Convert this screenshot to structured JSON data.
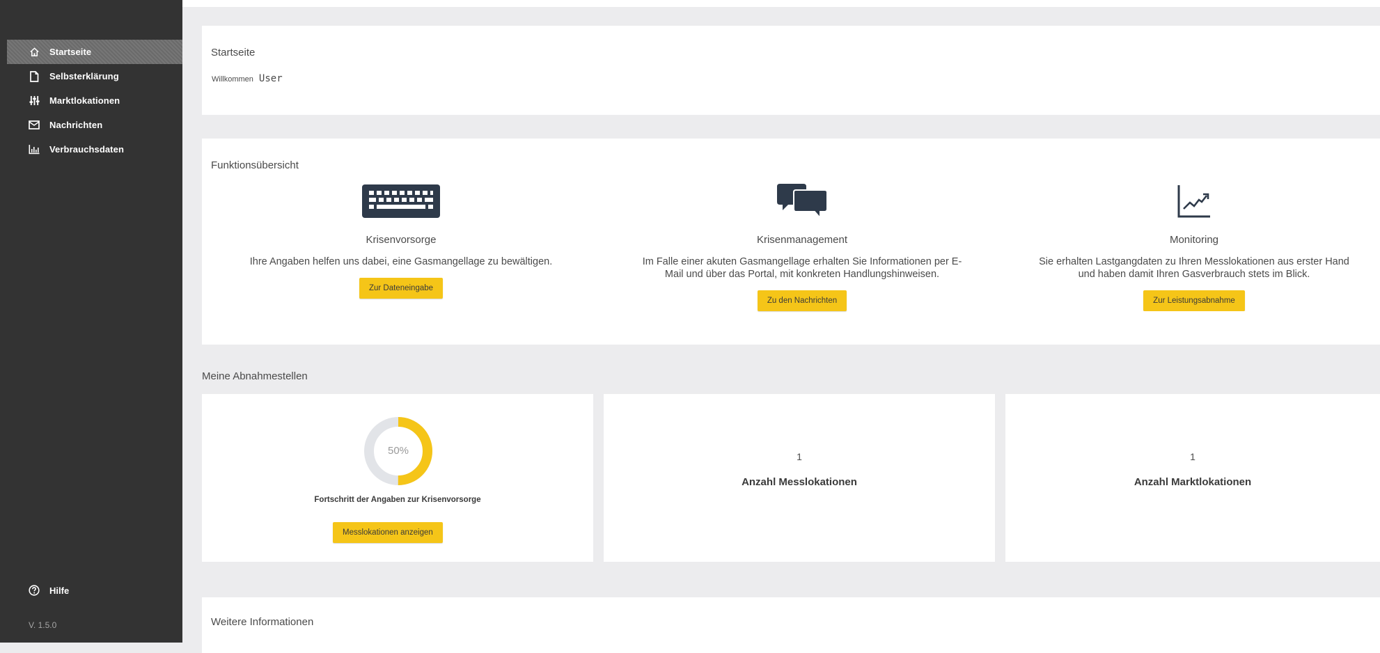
{
  "sidebar": {
    "items": [
      {
        "label": "Startseite",
        "icon": "home-icon"
      },
      {
        "label": "Selbsterklärung",
        "icon": "file-icon"
      },
      {
        "label": "Marktlokationen",
        "icon": "sliders-icon"
      },
      {
        "label": "Nachrichten",
        "icon": "mail-icon"
      },
      {
        "label": "Verbrauchsdaten",
        "icon": "bar-chart-icon"
      }
    ],
    "help_label": "Hilfe",
    "version": "V. 1.5.0"
  },
  "welcome": {
    "title": "Startseite",
    "greeting": "Willkommen",
    "user": "User"
  },
  "features": {
    "title": "Funktionsübersicht",
    "items": [
      {
        "name": "Krisenvorsorge",
        "icon": "keyboard-icon",
        "desc_line1": "Ihre Angaben helfen uns dabei, eine Gasmangellage zu bewältigen.",
        "desc_line2": "",
        "button": "Zur Dateneingabe"
      },
      {
        "name": "Krisenmanagement",
        "icon": "chat-icon",
        "desc_line1": "Im Falle einer akuten Gasmangellage erhalten Sie Informationen per E-",
        "desc_line2": "Mail und über das Portal, mit konkreten Handlungshinweisen.",
        "button": "Zu den Nachrichten"
      },
      {
        "name": "Monitoring",
        "icon": "trend-chart-icon",
        "desc_line1": "Sie erhalten Lastgangdaten zu Ihren Messlokationen aus erster Hand",
        "desc_line2": "und haben damit Ihren Gasverbrauch stets im Blick.",
        "button": "Zur Leistungsabnahme"
      }
    ]
  },
  "abnahmestellen": {
    "title": "Meine Abnahmestellen",
    "progress": {
      "value": 0.5,
      "label": "50%",
      "caption": "Fortschritt der Angaben zur Krisenvorsorge",
      "button": "Messlokationen anzeigen"
    },
    "messlokationen": {
      "count": "1",
      "label": "Anzahl Messlokationen"
    },
    "marktlokationen": {
      "count": "1",
      "label": "Anzahl Marktlokationen"
    }
  },
  "more": {
    "title": "Weitere Informationen"
  },
  "colors": {
    "sidebar_bg": "#333333",
    "accent_yellow": "#f5c518",
    "icon_dark": "#2e3a4a",
    "donut_track": "#e2e4e8"
  }
}
